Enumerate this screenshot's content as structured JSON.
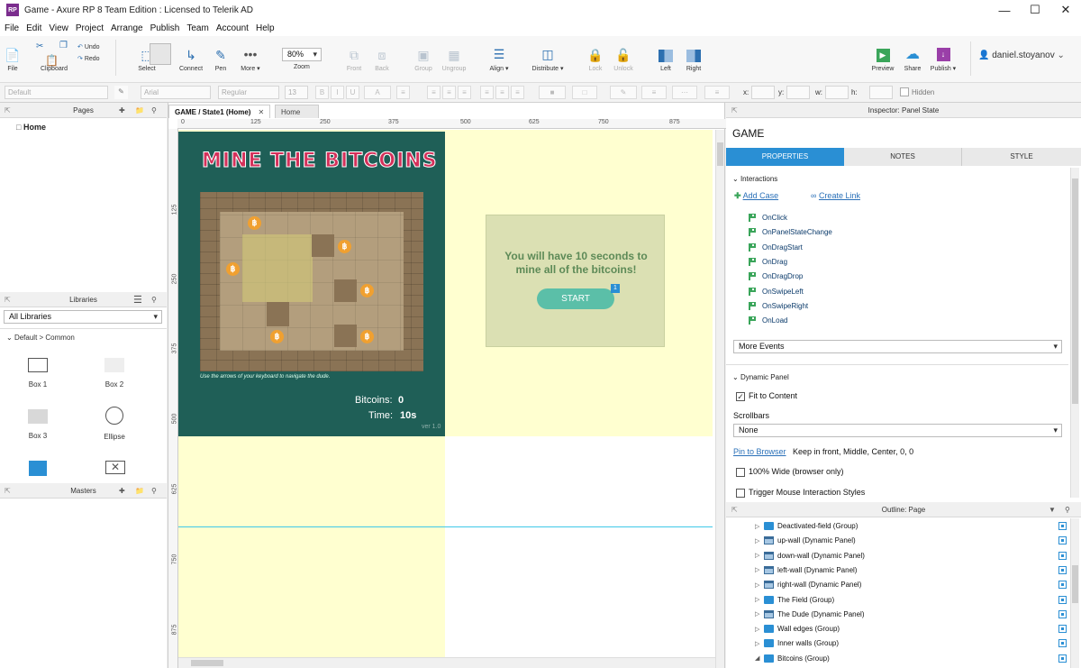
{
  "window": {
    "title": "Game - Axure RP 8 Team Edition : Licensed to Telerik AD",
    "app_icon": "RP"
  },
  "menu": [
    "File",
    "Edit",
    "View",
    "Project",
    "Arrange",
    "Publish",
    "Team",
    "Account",
    "Help"
  ],
  "toolbar": {
    "file": "File",
    "clipboard": "Clipboard",
    "undo": "Undo",
    "redo": "Redo",
    "select": "Select",
    "connect": "Connect",
    "pen": "Pen",
    "more": "More ▾",
    "zoom": "80%",
    "zoom_label": "Zoom",
    "front": "Front",
    "back": "Back",
    "group": "Group",
    "ungroup": "Ungroup",
    "align": "Align ▾",
    "distribute": "Distribute ▾",
    "lock": "Lock",
    "unlock": "Unlock",
    "left": "Left",
    "right": "Right",
    "preview": "Preview",
    "share": "Share",
    "publish": "Publish ▾",
    "user": "daniel.stoyanov"
  },
  "format": {
    "style": "Default",
    "font": "Arial",
    "weight": "Regular",
    "size": "13",
    "x_label": "x:",
    "y_label": "y:",
    "w_label": "w:",
    "h_label": "h:",
    "hidden": "Hidden"
  },
  "pages": {
    "header": "Pages",
    "items": [
      "Home"
    ]
  },
  "libraries": {
    "header": "Libraries",
    "select": "All Libraries",
    "group": "Default > Common",
    "items": [
      "Box 1",
      "Box 2",
      "Box 3",
      "Ellipse"
    ]
  },
  "masters": {
    "header": "Masters"
  },
  "tabs": [
    "GAME / State1 (Home)",
    "Home"
  ],
  "ruler_top": [
    "0",
    "125",
    "250",
    "375",
    "500",
    "625",
    "750",
    "875"
  ],
  "ruler_left": [
    "125",
    "250",
    "375",
    "500",
    "625",
    "750",
    "875"
  ],
  "game": {
    "title": "MINE THE BITCOINS",
    "hint": "Use the arrows of your keyboard to navigate the dude.",
    "bitcoins_label": "Bitcoins:",
    "bitcoins_value": "0",
    "time_label": "Time:",
    "time_value": "10s",
    "version": "ver 1.0",
    "message": "You will have 10 seconds to mine all of the bitcoins!",
    "start": "START",
    "badge": "1",
    "coin_symbol": "฿"
  },
  "inspector": {
    "header": "Inspector: Panel State",
    "name": "GAME",
    "tabs": [
      "PROPERTIES",
      "NOTES",
      "STYLE"
    ],
    "interactions": "Interactions",
    "add_case": "Add Case",
    "create_link": "Create Link",
    "events": [
      "OnClick",
      "OnPanelStateChange",
      "OnDragStart",
      "OnDrag",
      "OnDragDrop",
      "OnSwipeLeft",
      "OnSwipeRight",
      "OnLoad"
    ],
    "more_events": "More Events",
    "dynamic_panel": "Dynamic Panel",
    "fit_to_content": "Fit to Content",
    "scrollbars_label": "Scrollbars",
    "scrollbars_value": "None",
    "pin_link": "Pin to Browser",
    "pin_text": "Keep in front, Middle, Center, 0, 0",
    "wide": "100% Wide (browser only)",
    "trigger": "Trigger Mouse Interaction Styles"
  },
  "outline": {
    "header": "Outline: Page",
    "items": [
      {
        "label": "Deactivated-field (Group)",
        "type": "group"
      },
      {
        "label": "up-wall (Dynamic Panel)",
        "type": "panel"
      },
      {
        "label": "down-wall (Dynamic Panel)",
        "type": "panel"
      },
      {
        "label": "left-wall (Dynamic Panel)",
        "type": "panel"
      },
      {
        "label": "right-wall (Dynamic Panel)",
        "type": "panel"
      },
      {
        "label": "The Field (Group)",
        "type": "group"
      },
      {
        "label": "The Dude (Dynamic Panel)",
        "type": "panel"
      },
      {
        "label": "Wall edges (Group)",
        "type": "group"
      },
      {
        "label": "Inner walls (Group)",
        "type": "group"
      },
      {
        "label": "Bitcoins (Group)",
        "type": "group"
      }
    ]
  },
  "colors": {
    "game_bg": "#1f5f57",
    "title": "#d4305a",
    "yellow": "#ffffd0",
    "button": "#5bbfa8",
    "accent": "#2a8fd4",
    "tab_active": "#2a8fd4"
  }
}
